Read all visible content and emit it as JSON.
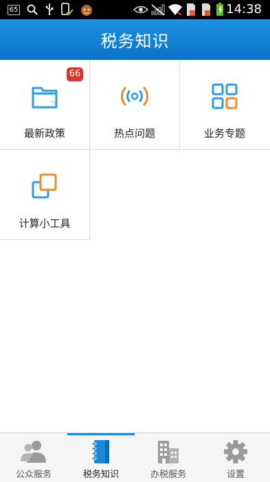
{
  "status_bar": {
    "notification_count": "65",
    "time": "14:38"
  },
  "header": {
    "title": "税务知识"
  },
  "grid": {
    "items": [
      {
        "label": "最新政策",
        "icon": "folder-icon",
        "badge": "66"
      },
      {
        "label": "热点问题",
        "icon": "broadcast-icon"
      },
      {
        "label": "业务专题",
        "icon": "grid-icon"
      },
      {
        "label": "计算小工具",
        "icon": "calculator-copy-icon"
      }
    ]
  },
  "tabbar": {
    "active_index": 1,
    "items": [
      {
        "label": "公众服务",
        "icon": "people-icon"
      },
      {
        "label": "税务知识",
        "icon": "notebook-icon"
      },
      {
        "label": "办税服务",
        "icon": "building-icon"
      },
      {
        "label": "设置",
        "icon": "gear-icon"
      }
    ]
  },
  "colors": {
    "header_bg": "#1580d2",
    "accent_blue": "#2a9be6",
    "accent_orange": "#f08a24",
    "badge_red": "#d9342b",
    "tab_inactive": "#9a9a9a",
    "tab_active": "#1a8ad8"
  }
}
